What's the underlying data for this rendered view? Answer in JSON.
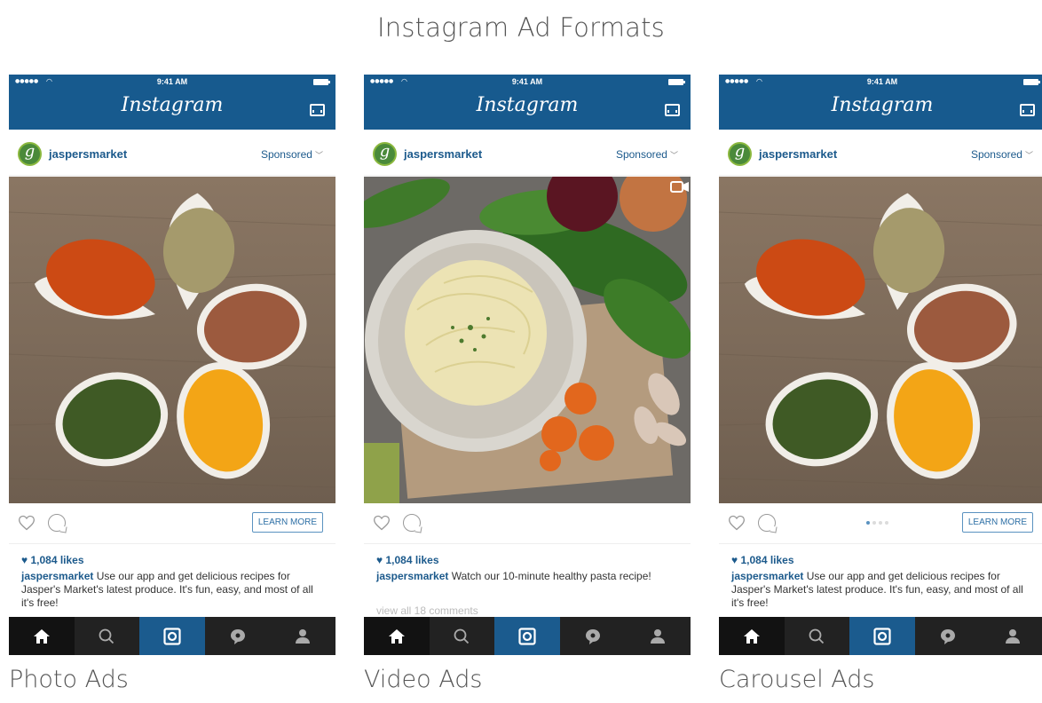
{
  "page": {
    "title": "Instagram Ad Formats"
  },
  "phones": [
    {
      "status": {
        "signal": "●●●●● ",
        "time": "9:41 AM"
      },
      "app_title": "Instagram",
      "post": {
        "username": "jaspersmarket",
        "sponsored_label": "Sponsored",
        "media": "spices-flower",
        "cta_label": "LEARN MORE",
        "likes": "♥ 1,084 likes",
        "caption_user": "jaspersmarket",
        "caption_text": " Use our app and get delicious recipes for Jasper's Market's latest produce. It's fun, easy, and most of all it's free!"
      },
      "label": "Photo Ads"
    },
    {
      "status": {
        "signal": "●●●●● ",
        "time": "9:41 AM"
      },
      "app_title": "Instagram",
      "post": {
        "username": "jaspersmarket",
        "sponsored_label": "Sponsored",
        "media": "pasta-vegetables",
        "likes": "♥ 1,084 likes",
        "caption_user": "jaspersmarket",
        "caption_text": " Watch our 10-minute healthy pasta recipe!",
        "view_comments": "view all 18 comments"
      },
      "label": "Video Ads"
    },
    {
      "status": {
        "signal": "●●●●● ",
        "time": "9:41 AM"
      },
      "app_title": "Instagram",
      "post": {
        "username": "jaspersmarket",
        "sponsored_label": "Sponsored",
        "media": "spices-flower",
        "cta_label": "LEARN MORE",
        "carousel_dots": {
          "count": 4,
          "active": 1
        },
        "likes": "♥ 1,084 likes",
        "caption_user": "jaspersmarket",
        "caption_text": " Use our app and get delicious recipes for Jasper's Market's latest produce. It's fun, easy, and most of all it's free!"
      },
      "label": "Carousel Ads"
    }
  ],
  "tabbar_icons": [
    "home-icon",
    "search-icon",
    "camera-icon",
    "activity-icon",
    "profile-icon"
  ],
  "colors": {
    "header_blue": "#175a8e",
    "link_blue": "#1c5a8c",
    "tabbar": "#222222",
    "tab_active": "#1b5b8e"
  }
}
